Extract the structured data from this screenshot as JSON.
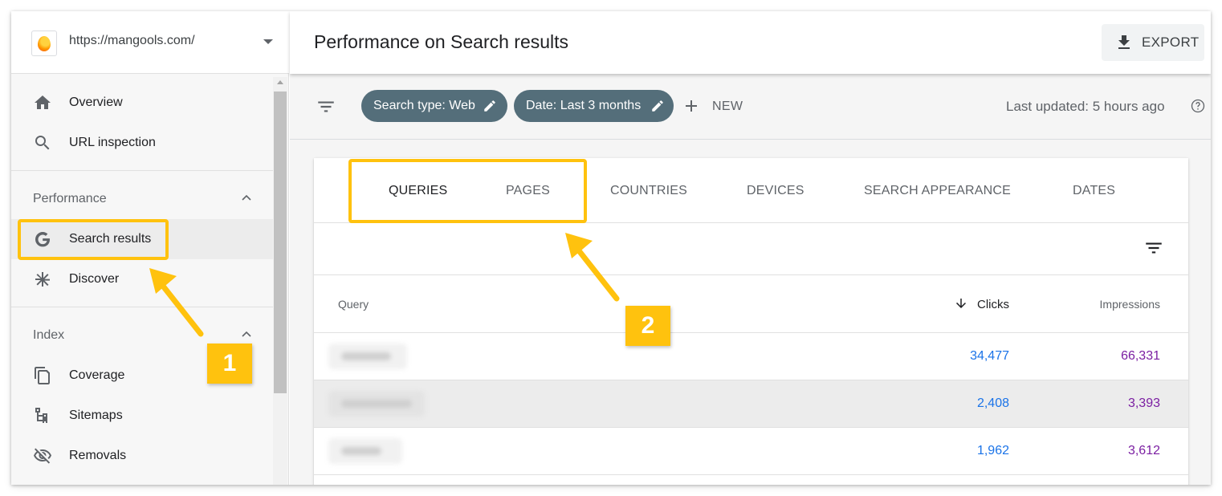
{
  "sidebar": {
    "property_url": "https://mangools.com/",
    "nav_top": [
      {
        "label": "Overview",
        "icon": "home-icon"
      },
      {
        "label": "URL inspection",
        "icon": "search-icon"
      }
    ],
    "performance": {
      "heading": "Performance",
      "items": [
        {
          "label": "Search results",
          "icon": "google-g-icon"
        },
        {
          "label": "Discover",
          "icon": "asterisk-icon"
        }
      ]
    },
    "index": {
      "heading": "Index",
      "items": [
        {
          "label": "Coverage",
          "icon": "copy-icon"
        },
        {
          "label": "Sitemaps",
          "icon": "sitemap-icon"
        },
        {
          "label": "Removals",
          "icon": "eye-off-icon"
        }
      ]
    }
  },
  "header": {
    "title": "Performance on Search results",
    "export_label": "EXPORT"
  },
  "filters": {
    "chips": [
      {
        "label": "Search type: Web"
      },
      {
        "label": "Date: Last 3 months"
      }
    ],
    "new_label": "NEW",
    "last_updated": "Last updated: 5 hours ago"
  },
  "tabs": [
    "QUERIES",
    "PAGES",
    "COUNTRIES",
    "DEVICES",
    "SEARCH APPEARANCE",
    "DATES"
  ],
  "table": {
    "columns": {
      "query": "Query",
      "clicks": "Clicks",
      "impressions": "Impressions"
    },
    "rows": [
      {
        "clicks": "34,477",
        "impressions": "66,331"
      },
      {
        "clicks": "2,408",
        "impressions": "3,393"
      },
      {
        "clicks": "1,962",
        "impressions": "3,612"
      }
    ]
  },
  "annotations": {
    "badge1": "1",
    "badge2": "2",
    "color": "#ffc20e"
  },
  "colors": {
    "chip_bg": "#546e7a",
    "clicks": "#1a73e8",
    "impressions": "#7b1fa2"
  }
}
